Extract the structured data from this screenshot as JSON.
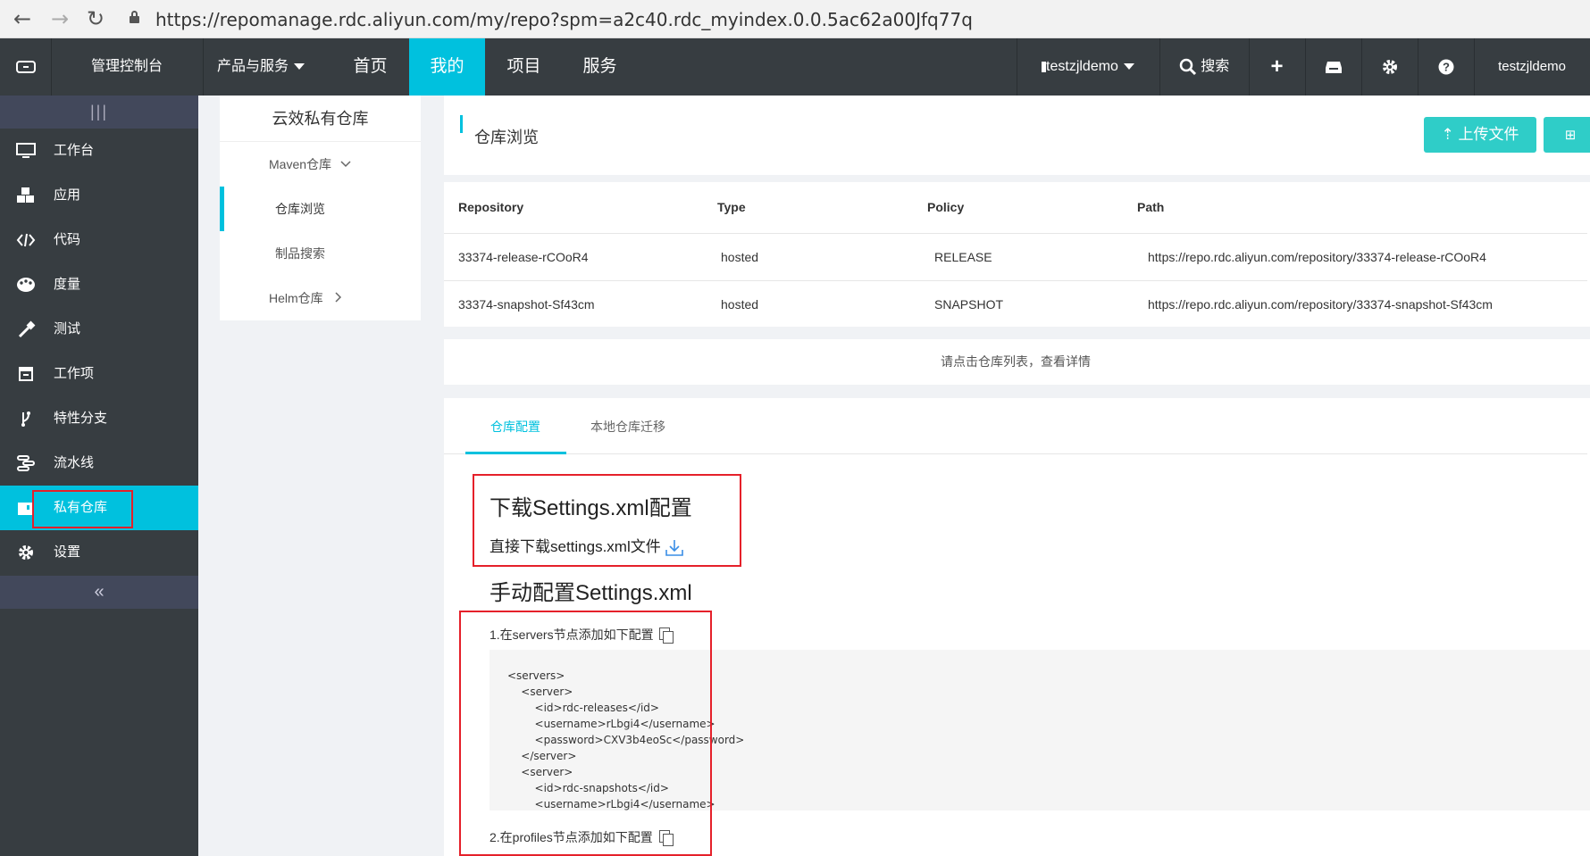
{
  "browser": {
    "url": "https://repomanage.rdc.aliyun.com/my/repo?spm=a2c40.rdc_myindex.0.0.5ac62a00Jfq77q"
  },
  "topnav": {
    "console": "管理控制台",
    "products": "产品与服务",
    "home": "首页",
    "mine": "我的",
    "project": "项目",
    "service": "服务",
    "org": "testzjldemo",
    "search": "搜索",
    "user": "testzjldemo"
  },
  "sidebar": {
    "items": [
      {
        "label": "工作台",
        "icon": "monitor-icon"
      },
      {
        "label": "应用",
        "icon": "cubes-icon"
      },
      {
        "label": "代码",
        "icon": "code-icon"
      },
      {
        "label": "度量",
        "icon": "palette-icon"
      },
      {
        "label": "测试",
        "icon": "dropper-icon"
      },
      {
        "label": "工作项",
        "icon": "calendar-icon"
      },
      {
        "label": "特性分支",
        "icon": "branch-icon"
      },
      {
        "label": "流水线",
        "icon": "pipeline-icon"
      },
      {
        "label": "私有仓库",
        "icon": "repo-icon"
      },
      {
        "label": "设置",
        "icon": "gear-icon"
      }
    ],
    "collapse": "«"
  },
  "submenu": {
    "title": "云效私有仓库",
    "items": [
      "Maven仓库",
      "仓库浏览",
      "制品搜索",
      "Helm仓库"
    ]
  },
  "main": {
    "title": "仓库浏览",
    "upload": "上传文件",
    "headers": [
      "Repository",
      "Type",
      "Policy",
      "Path"
    ],
    "rows": [
      [
        "33374-release-rCOoR4",
        "hosted",
        "RELEASE",
        "https://repo.rdc.aliyun.com/repository/33374-release-rCOoR4"
      ],
      [
        "33374-snapshot-Sf43cm",
        "hosted",
        "SNAPSHOT",
        "https://repo.rdc.aliyun.com/repository/33374-snapshot-Sf43cm"
      ]
    ],
    "hint": "请点击仓库列表，查看详情",
    "tabs": [
      "仓库配置",
      "本地仓库迁移"
    ],
    "download_title": "下载Settings.xml配置",
    "download_link": "直接下载settings.xml文件",
    "manual_title": "手动配置Settings.xml",
    "step1": "1.在servers节点添加如下配置",
    "code1": "<servers>\n    <server>\n        <id>rdc-releases</id>\n        <username>rLbgi4</username>\n        <password>CXV3b4eoSc</password>\n    </server>\n    <server>\n        <id>rdc-snapshots</id>\n        <username>rLbgi4</username>",
    "step2": "2.在profiles节点添加如下配置"
  },
  "colors": {
    "accent": "#00c1de",
    "nav_bg": "#373d41",
    "upload_btn": "#2fcdc8",
    "highlight_box": "#e5202a"
  }
}
